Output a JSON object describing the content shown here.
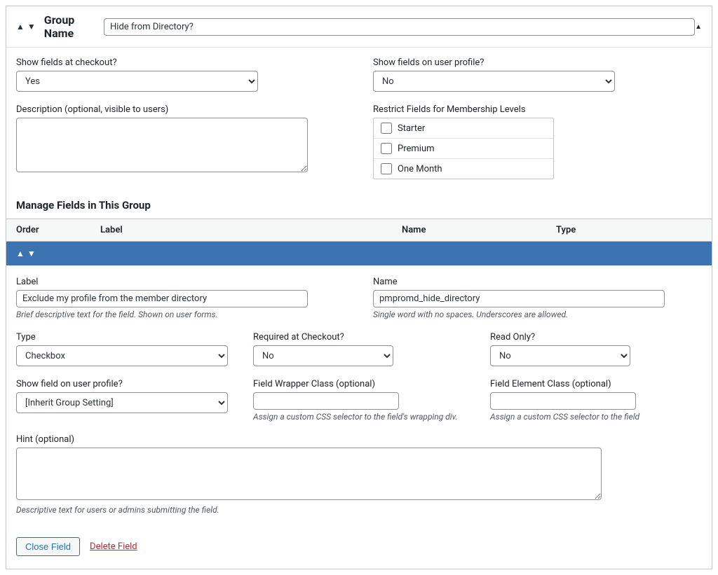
{
  "header": {
    "group_name_label": "Group Name",
    "group_name_value": "Hide from Directory?"
  },
  "group_settings": {
    "checkout_label": "Show fields at checkout?",
    "checkout_value": "Yes",
    "profile_label": "Show fields on user profile?",
    "profile_value": "No",
    "description_label": "Description (optional, visible to users)",
    "description_value": "",
    "restrict_label": "Restrict Fields for Membership Levels",
    "levels": [
      {
        "label": "Starter"
      },
      {
        "label": "Premium"
      },
      {
        "label": "One Month"
      }
    ]
  },
  "fields_section": {
    "heading": "Manage Fields in This Group",
    "columns": {
      "order": "Order",
      "label": "Label",
      "name": "Name",
      "type": "Type"
    }
  },
  "field": {
    "label_label": "Label",
    "label_value": "Exclude my profile from the member directory",
    "label_hint": "Brief descriptive text for the field. Shown on user forms.",
    "name_label": "Name",
    "name_value": "pmpromd_hide_directory",
    "name_hint": "Single word with no spaces. Underscores are allowed.",
    "type_label": "Type",
    "type_value": "Checkbox",
    "required_label": "Required at Checkout?",
    "required_value": "No",
    "readonly_label": "Read Only?",
    "readonly_value": "No",
    "profile_label": "Show field on user profile?",
    "profile_value": "[Inherit Group Setting]",
    "wrapper_class_label": "Field Wrapper Class (optional)",
    "wrapper_class_value": "",
    "wrapper_class_hint": "Assign a custom CSS selector to the field's wrapping div.",
    "element_class_label": "Field Element Class (optional)",
    "element_class_value": "",
    "element_class_hint": "Assign a custom CSS selector to the field",
    "hint_label": "Hint (optional)",
    "hint_value": "",
    "hint_hint": "Descriptive text for users or admins submitting the field."
  },
  "actions": {
    "close": "Close Field",
    "delete": "Delete Field"
  }
}
